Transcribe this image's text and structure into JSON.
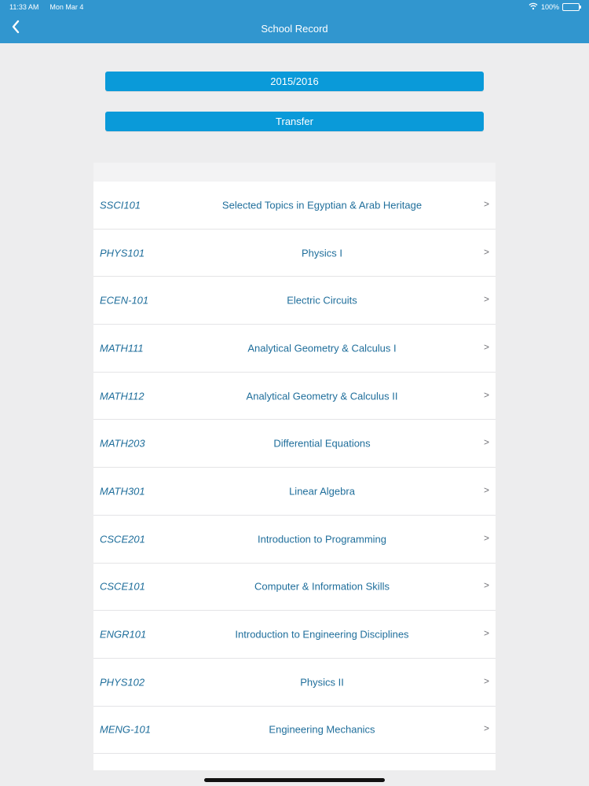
{
  "status_bar": {
    "time": "11:33 AM",
    "date": "Mon Mar 4",
    "battery": "100%"
  },
  "nav": {
    "title": "School Record"
  },
  "buttons": {
    "year": "2015/2016",
    "transfer": "Transfer"
  },
  "courses": [
    {
      "code": "SSCI101",
      "name": "Selected Topics in Egyptian & Arab Heritage"
    },
    {
      "code": "PHYS101",
      "name": "Physics I"
    },
    {
      "code": "ECEN-101",
      "name": "Electric Circuits"
    },
    {
      "code": "MATH111",
      "name": "Analytical Geometry & Calculus I"
    },
    {
      "code": "MATH112",
      "name": "Analytical Geometry & Calculus II"
    },
    {
      "code": "MATH203",
      "name": "Differential Equations"
    },
    {
      "code": "MATH301",
      "name": "Linear Algebra"
    },
    {
      "code": "CSCE201",
      "name": "Introduction to Programming"
    },
    {
      "code": "CSCE101",
      "name": "Computer & Information Skills"
    },
    {
      "code": "ENGR101",
      "name": "Introduction to Engineering Disciplines"
    },
    {
      "code": "PHYS102",
      "name": "Physics II"
    },
    {
      "code": "MENG-101",
      "name": "Engineering Mechanics"
    }
  ],
  "chevron": ">",
  "colors": {
    "nav": "#3196cf",
    "button": "#0a9ad9",
    "text": "#1f6e9b"
  },
  "icons": {
    "back": "chevron-left-icon",
    "wifi": "wifi-icon",
    "battery": "battery-icon"
  }
}
